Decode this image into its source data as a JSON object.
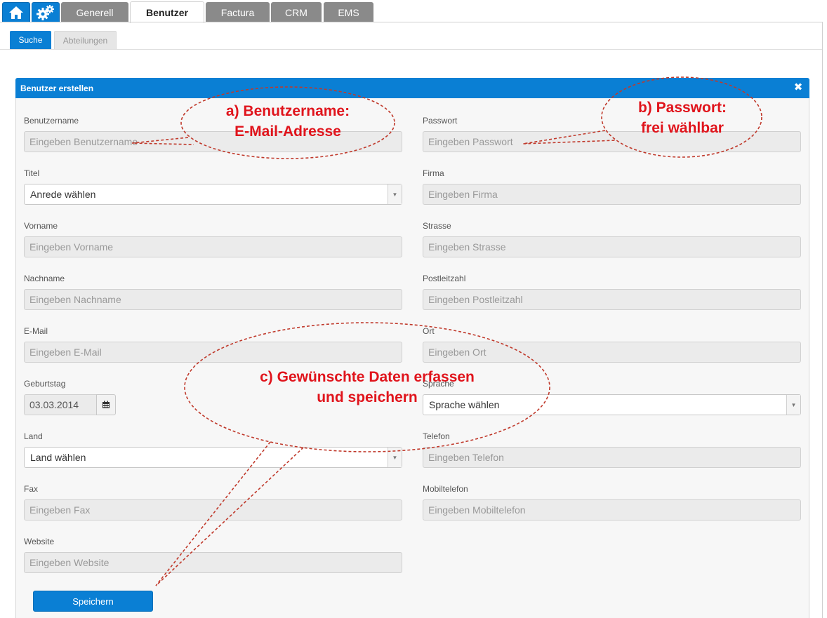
{
  "top_tabs": [
    {
      "label": "Generell",
      "active": false
    },
    {
      "label": "Benutzer",
      "active": true
    },
    {
      "label": "Factura",
      "active": false
    },
    {
      "label": "CRM",
      "active": false
    },
    {
      "label": "EMS",
      "active": false
    }
  ],
  "icons": {
    "home": "home-icon",
    "settings": "gear-icon",
    "close": "close-icon",
    "calendar": "calendar-icon"
  },
  "sub_tabs": [
    {
      "label": "Suche",
      "active": true
    },
    {
      "label": "Abteilungen",
      "active": false
    }
  ],
  "panel": {
    "title": "Benutzer erstellen",
    "close": "✖"
  },
  "form": {
    "left": [
      {
        "label": "Benutzername",
        "placeholder": "Eingeben Benutzername"
      },
      {
        "label": "Titel",
        "value": "Anrede wählen"
      },
      {
        "label": "Vorname",
        "placeholder": "Eingeben Vorname"
      },
      {
        "label": "Nachname",
        "placeholder": "Eingeben Nachname"
      },
      {
        "label": "E-Mail",
        "placeholder": "Eingeben E-Mail"
      },
      {
        "label": "Geburtstag",
        "value": "03.03.2014"
      },
      {
        "label": "Land",
        "value": "Land wählen"
      },
      {
        "label": "Fax",
        "placeholder": "Eingeben Fax"
      },
      {
        "label": "Website",
        "placeholder": "Eingeben Website"
      }
    ],
    "right": [
      {
        "label": "Passwort",
        "placeholder": "Eingeben Passwort"
      },
      {
        "label": "Firma",
        "placeholder": "Eingeben Firma"
      },
      {
        "label": "Strasse",
        "placeholder": "Eingeben Strasse"
      },
      {
        "label": "Postleitzahl",
        "placeholder": "Eingeben Postleitzahl"
      },
      {
        "label": "Ort",
        "placeholder": "Eingeben Ort"
      },
      {
        "label": "Sprache",
        "value": "Sprache wählen"
      },
      {
        "label": "Telefon",
        "placeholder": "Eingeben Telefon"
      },
      {
        "label": "Mobiltelefon",
        "placeholder": "Eingeben Mobiltelefon"
      }
    ],
    "save_label": "Speichern"
  },
  "annotations": {
    "a_line1": "a) Benutzername:",
    "a_line2": "E-Mail-Adresse",
    "b_line1": "b) Passwort:",
    "b_line2": "frei wählbar",
    "c_line1": "c) Gewünschte Daten erfassen",
    "c_line2": "und speichern"
  },
  "colors": {
    "accent": "#0a7fd4",
    "annotation": "#e0141c",
    "annotation_outline": "#c0392b"
  }
}
